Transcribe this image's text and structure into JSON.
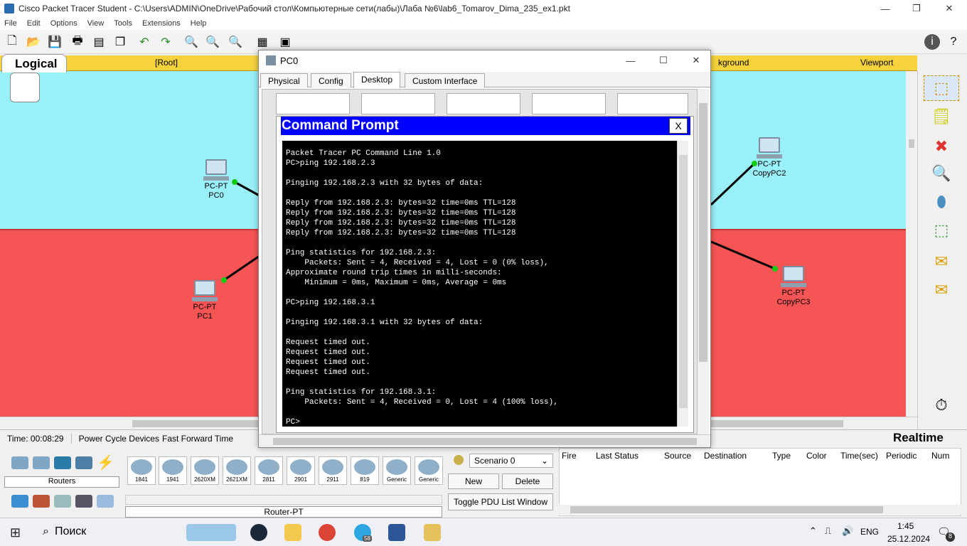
{
  "window": {
    "title": "Cisco Packet Tracer Student - C:\\Users\\ADMIN\\OneDrive\\Рабочий стол\\Компьютерные сети(лабы)\\Лаба №6\\lab6_Tomarov_Dima_235_ex1.pkt",
    "minimize": "—",
    "restore": "❐",
    "close": "✕"
  },
  "menu": [
    "File",
    "Edit",
    "Options",
    "View",
    "Tools",
    "Extensions",
    "Help"
  ],
  "workspace": {
    "mode": "Logical",
    "root": "[Root]",
    "background": "kground",
    "viewport": "Viewport"
  },
  "devices": [
    {
      "model": "PC-PT",
      "name": "PC0"
    },
    {
      "model": "PC-PT",
      "name": "PC1"
    },
    {
      "model": "PC-PT",
      "name": "CopyPC2"
    },
    {
      "model": "PC-PT",
      "name": "CopyPC3"
    }
  ],
  "pc_window": {
    "title": "PC0",
    "minimize": "—",
    "maximize": "☐",
    "close": "✕",
    "tabs": [
      "Physical",
      "Config",
      "Desktop",
      "Custom Interface"
    ],
    "active_tab": "Desktop"
  },
  "cmd": {
    "title": "Command Prompt",
    "close": "X",
    "output": "Packet Tracer PC Command Line 1.0\nPC>ping 192.168.2.3\n\nPinging 192.168.2.3 with 32 bytes of data:\n\nReply from 192.168.2.3: bytes=32 time=0ms TTL=128\nReply from 192.168.2.3: bytes=32 time=0ms TTL=128\nReply from 192.168.2.3: bytes=32 time=0ms TTL=128\nReply from 192.168.2.3: bytes=32 time=0ms TTL=128\n\nPing statistics for 192.168.2.3:\n    Packets: Sent = 4, Received = 4, Lost = 0 (0% loss),\nApproximate round trip times in milli-seconds:\n    Minimum = 0ms, Maximum = 0ms, Average = 0ms\n\nPC>ping 192.168.3.1\n\nPinging 192.168.3.1 with 32 bytes of data:\n\nRequest timed out.\nRequest timed out.\nRequest timed out.\nRequest timed out.\n\nPing statistics for 192.168.3.1:\n    Packets: Sent = 4, Received = 0, Lost = 4 (100% loss),\n\nPC>"
  },
  "status": {
    "time": "Time: 00:08:29",
    "power_cycle": "Power Cycle Devices",
    "fast_forward": "Fast Forward Time",
    "realtime": "Realtime"
  },
  "device_panel": {
    "category": "Routers",
    "selected": "Router-PT",
    "models": [
      "1841",
      "1941",
      "2620XM",
      "2621XM",
      "2811",
      "2901",
      "2911",
      "819",
      "Generic",
      "Generic"
    ]
  },
  "scenario": {
    "selected": "Scenario 0",
    "new": "New",
    "delete": "Delete",
    "toggle": "Toggle PDU List Window"
  },
  "pdu_columns": [
    "Fire",
    "Last Status",
    "Source",
    "Destination",
    "Type",
    "Color",
    "Time(sec)",
    "Periodic",
    "Num"
  ],
  "taskbar": {
    "search": "Поиск",
    "lang": "ENG",
    "time": "1:45",
    "date": "25.12.2024",
    "notif": "8",
    "telegram_badge": "58"
  }
}
